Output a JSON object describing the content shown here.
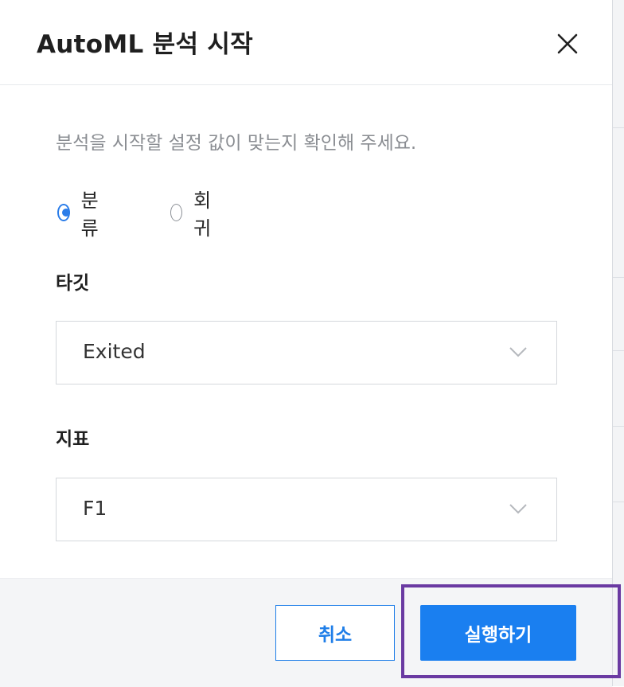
{
  "dialog": {
    "title": "AutoML 분석 시작",
    "description": "분석을 시작할 설정 값이 맞는지 확인해 주세요."
  },
  "analysis_type": {
    "options": [
      {
        "label": "분류",
        "selected": true
      },
      {
        "label": "회귀",
        "selected": false
      }
    ]
  },
  "target": {
    "label": "타깃",
    "value": "Exited"
  },
  "metric": {
    "label": "지표",
    "value": "F1"
  },
  "footer": {
    "cancel_label": "취소",
    "run_label": "실행하기"
  },
  "colors": {
    "accent": "#1a7ff0",
    "highlight": "#6a3aa2"
  },
  "icons": {
    "close": "close-icon",
    "select_arrow": "chevron-down-icon"
  }
}
